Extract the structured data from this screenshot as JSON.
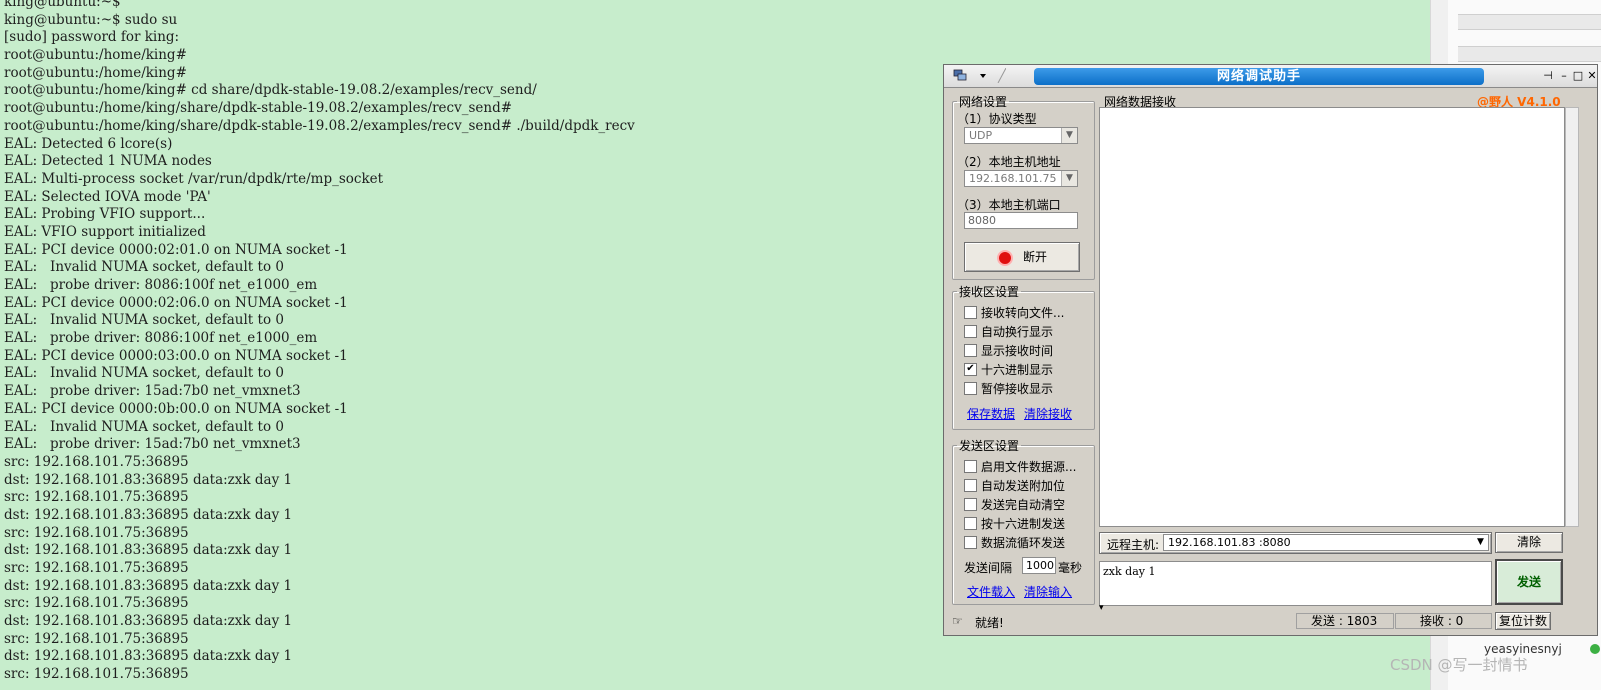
{
  "terminal": {
    "lines": [
      "king@ubuntu:~$",
      "king@ubuntu:~$ sudo su",
      "[sudo] password for king:",
      "root@ubuntu:/home/king#",
      "root@ubuntu:/home/king#",
      "root@ubuntu:/home/king# cd share/dpdk-stable-19.08.2/examples/recv_send/",
      "root@ubuntu:/home/king/share/dpdk-stable-19.08.2/examples/recv_send#",
      "root@ubuntu:/home/king/share/dpdk-stable-19.08.2/examples/recv_send# ./build/dpdk_recv",
      "EAL: Detected 6 lcore(s)",
      "EAL: Detected 1 NUMA nodes",
      "EAL: Multi-process socket /var/run/dpdk/rte/mp_socket",
      "EAL: Selected IOVA mode 'PA'",
      "EAL: Probing VFIO support...",
      "EAL: VFIO support initialized",
      "EAL: PCI device 0000:02:01.0 on NUMA socket -1",
      "EAL:   Invalid NUMA socket, default to 0",
      "EAL:   probe driver: 8086:100f net_e1000_em",
      "EAL: PCI device 0000:02:06.0 on NUMA socket -1",
      "EAL:   Invalid NUMA socket, default to 0",
      "EAL:   probe driver: 8086:100f net_e1000_em",
      "EAL: PCI device 0000:03:00.0 on NUMA socket -1",
      "EAL:   Invalid NUMA socket, default to 0",
      "EAL:   probe driver: 15ad:7b0 net_vmxnet3",
      "EAL: PCI device 0000:0b:00.0 on NUMA socket -1",
      "EAL:   Invalid NUMA socket, default to 0",
      "EAL:   probe driver: 15ad:7b0 net_vmxnet3",
      "src: 192.168.101.75:36895",
      "dst: 192.168.101.83:36895 data:zxk day 1",
      "src: 192.168.101.75:36895",
      "dst: 192.168.101.83:36895 data:zxk day 1",
      "src: 192.168.101.75:36895",
      "dst: 192.168.101.83:36895 data:zxk day 1",
      "src: 192.168.101.75:36895",
      "dst: 192.168.101.83:36895 data:zxk day 1",
      "src: 192.168.101.75:36895",
      "dst: 192.168.101.83:36895 data:zxk day 1",
      "src: 192.168.101.75:36895",
      "dst: 192.168.101.83:36895 data:zxk day 1",
      "src: 192.168.101.75:36895"
    ],
    "background": "#c7edcc"
  },
  "netassist": {
    "title": "网络调试助手",
    "version": "@野人 V4.1.0",
    "version_color": "#ff6600",
    "net_settings": {
      "legend": "网络设置",
      "protocol_label": "（1）协议类型",
      "protocol_value": "UDP",
      "host_label": "（2）本地主机地址",
      "host_value": "192.168.101.75",
      "port_label": "（3）本地主机端口",
      "port_value": "8080",
      "disconnect_label": "断开"
    },
    "recv_settings": {
      "legend": "接收区设置",
      "options": [
        {
          "label": "接收转向文件...",
          "checked": false
        },
        {
          "label": "自动换行显示",
          "checked": false
        },
        {
          "label": "显示接收时间",
          "checked": false
        },
        {
          "label": "十六进制显示",
          "checked": true
        },
        {
          "label": "暂停接收显示",
          "checked": false
        }
      ],
      "save_link": "保存数据",
      "clear_link": "清除接收"
    },
    "send_settings": {
      "legend": "发送区设置",
      "options": [
        {
          "label": "启用文件数据源...",
          "checked": false
        },
        {
          "label": "自动发送附加位",
          "checked": false
        },
        {
          "label": "发送完自动清空",
          "checked": false
        },
        {
          "label": "按十六进制发送",
          "checked": false
        },
        {
          "label": "数据流循环发送",
          "checked": false
        }
      ],
      "interval_label": "发送间隔",
      "interval_value": "1000",
      "interval_unit": "毫秒",
      "file_load_link": "文件载入",
      "clear_input_link": "清除输入"
    },
    "recv_area_label": "网络数据接收",
    "remote_host_label": "远程主机:",
    "remote_host_value": "192.168.101.83 :8080",
    "clear_button": "清除",
    "send_text": "zxk day 1",
    "send_button": "发送",
    "status": {
      "ready": "就绪!",
      "sent": "发送 : 1803",
      "received": "接收 : 0",
      "reset": "复位计数"
    }
  },
  "side": {
    "fragment": "yeasyinesnyj",
    "watermark": "CSDN @写一封情书"
  }
}
